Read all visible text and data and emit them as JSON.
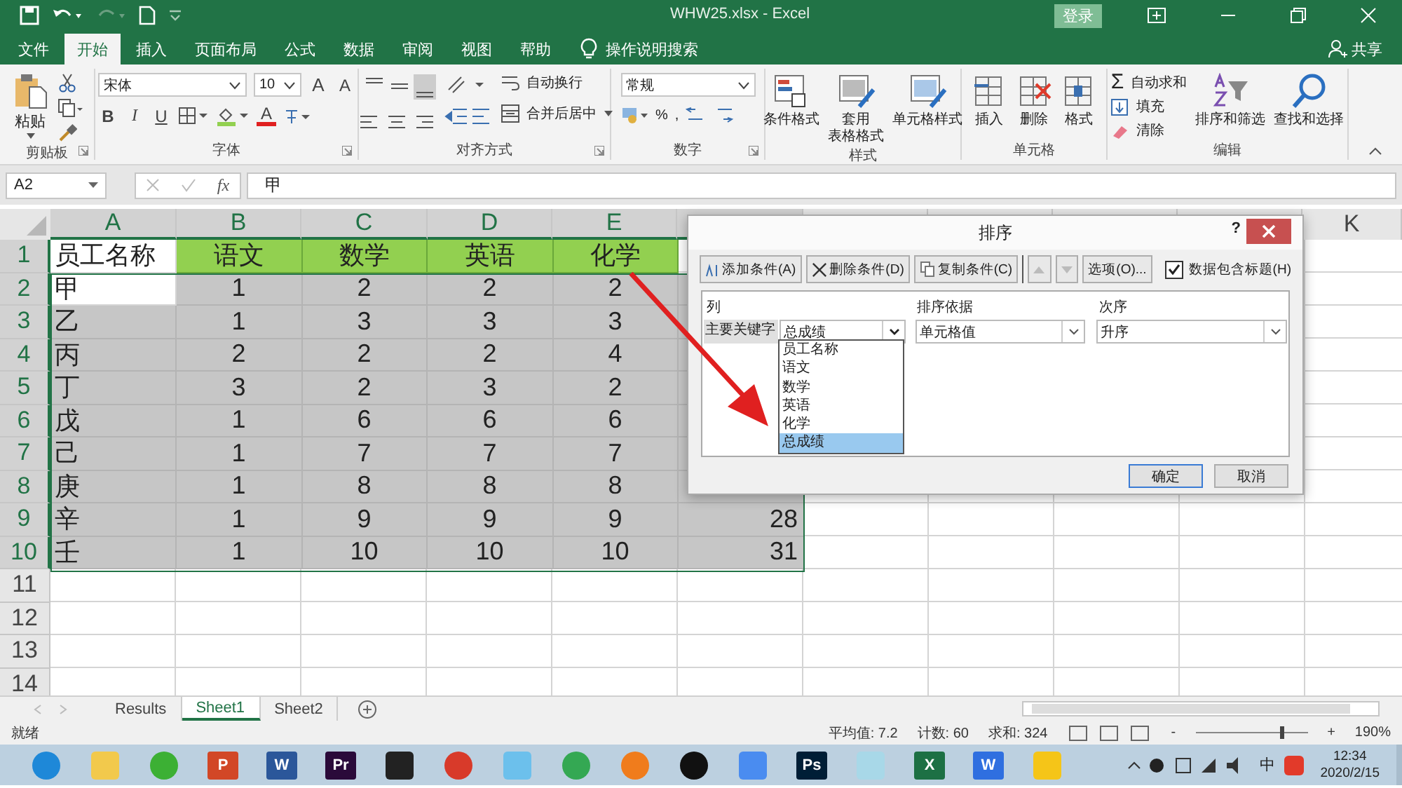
{
  "window": {
    "title": "WHW25.xlsx  -  Excel",
    "sign_in": "登录",
    "share": "共享"
  },
  "menu_tabs": [
    {
      "label": "文件",
      "selected": false
    },
    {
      "label": "开始",
      "selected": true
    },
    {
      "label": "插入",
      "selected": false
    },
    {
      "label": "页面布局",
      "selected": false
    },
    {
      "label": "公式",
      "selected": false
    },
    {
      "label": "数据",
      "selected": false
    },
    {
      "label": "审阅",
      "selected": false
    },
    {
      "label": "视图",
      "selected": false
    },
    {
      "label": "帮助",
      "selected": false
    }
  ],
  "tell_me": "操作说明搜索",
  "ribbon": {
    "clipboard": {
      "paste": "粘贴",
      "label": "剪贴板"
    },
    "font": {
      "name": "宋体",
      "size": "10",
      "grow": "A",
      "shrink": "A",
      "bold": "B",
      "italic": "I",
      "underline": "U",
      "color_glyph": "A",
      "label": "字体"
    },
    "alignment": {
      "wrap": "自动换行",
      "merge": "合并后居中",
      "label": "对齐方式"
    },
    "number": {
      "format": "常规",
      "percent": "%",
      "comma": ",",
      "label": "数字"
    },
    "styles": {
      "items": [
        {
          "lines": [
            "条件格式"
          ]
        },
        {
          "lines": [
            "套用",
            "表格格式"
          ]
        },
        {
          "lines": [
            "单元格样式"
          ]
        }
      ],
      "label": "样式"
    },
    "cells": {
      "items": [
        "插入",
        "删除",
        "格式"
      ],
      "label": "单元格"
    },
    "editing": {
      "sum_symbol": "Σ",
      "autosum": "自动求和",
      "fill": "填充",
      "clear": "清除",
      "sort": "排序和筛选",
      "find": "查找和选择",
      "label": "编辑"
    }
  },
  "formula_bar": {
    "name_box": "A2",
    "fx": "fx",
    "value": "甲"
  },
  "sheet": {
    "column_headers": [
      "A",
      "B",
      "C",
      "D",
      "E"
    ],
    "far_column_header": "K",
    "header_row": {
      "number": "1",
      "name": "员工名称",
      "subjects": [
        "语文",
        "数学",
        "英语",
        "化学"
      ]
    },
    "rows": [
      {
        "number": "2",
        "name": "甲",
        "scores": [
          "1",
          "2",
          "2",
          "2"
        ],
        "selected": true,
        "active": true
      },
      {
        "number": "3",
        "name": "乙",
        "scores": [
          "1",
          "3",
          "3",
          "3"
        ],
        "selected": true,
        "active": false
      },
      {
        "number": "4",
        "name": "丙",
        "scores": [
          "2",
          "2",
          "2",
          "4"
        ],
        "selected": true,
        "active": false
      },
      {
        "number": "5",
        "name": "丁",
        "scores": [
          "3",
          "2",
          "3",
          "2"
        ],
        "selected": true,
        "active": false
      },
      {
        "number": "6",
        "name": "戊",
        "scores": [
          "1",
          "6",
          "6",
          "6"
        ],
        "selected": true,
        "active": false
      },
      {
        "number": "7",
        "name": "己",
        "scores": [
          "1",
          "7",
          "7",
          "7"
        ],
        "selected": true,
        "active": false
      },
      {
        "number": "8",
        "name": "庚",
        "scores": [
          "1",
          "8",
          "8",
          "8"
        ],
        "selected": true,
        "active": false
      },
      {
        "number": "9",
        "name": "辛",
        "scores": [
          "1",
          "9",
          "9",
          "9"
        ],
        "total": "28",
        "selected": true,
        "active": false
      },
      {
        "number": "10",
        "name": "壬",
        "scores": [
          "1",
          "10",
          "10",
          "10"
        ],
        "total": "31",
        "selected": true,
        "active": false
      }
    ],
    "empty_rows": [
      "11",
      "12",
      "13",
      "14"
    ]
  },
  "sheet_tabs": [
    {
      "label": "Results",
      "selected": false
    },
    {
      "label": "Sheet1",
      "selected": true
    },
    {
      "label": "Sheet2",
      "selected": false
    }
  ],
  "status_bar": {
    "mode": "就绪",
    "average": "平均值: 7.2",
    "count": "计数: 60",
    "sum": "求和: 324",
    "zoom_out": "-",
    "zoom_slider": {
      "level": 0.76
    },
    "zoom_in": "+",
    "zoom": "190%"
  },
  "sort_dialog": {
    "title": "排序",
    "help": "?",
    "add": "添加条件(A)",
    "delete": "删除条件(D)",
    "copy": "复制条件(C)",
    "options": "选项(O)...",
    "has_headers": {
      "label": "数据包含标题(H)",
      "checked": true
    },
    "headers": [
      "列",
      "排序依据",
      "次序"
    ],
    "row_label": "主要关键字",
    "column_value": "总成绩",
    "sort_on": "单元格值",
    "order": "升序",
    "dropdown": [
      {
        "label": "员工名称",
        "selected": false
      },
      {
        "label": "语文",
        "selected": false
      },
      {
        "label": "数学",
        "selected": false
      },
      {
        "label": "英语",
        "selected": false
      },
      {
        "label": "化学",
        "selected": false
      },
      {
        "label": "总成绩",
        "selected": true
      }
    ],
    "ok": "确定",
    "cancel": "取消"
  },
  "taskbar": {
    "apps": [
      {
        "kind": "circle",
        "color": "#1e88d8"
      },
      {
        "kind": "square",
        "color": "#f2c94c"
      },
      {
        "kind": "circle",
        "color": "#3cb034"
      },
      {
        "kind": "glyph",
        "color": "#d24726",
        "glyph": "P"
      },
      {
        "kind": "glyph",
        "color": "#2b579a",
        "glyph": "W"
      },
      {
        "kind": "glyph",
        "color": "#2a0a3a",
        "glyph": "Pr"
      },
      {
        "kind": "square",
        "color": "#222222"
      },
      {
        "kind": "circle",
        "color": "#d83a2a"
      },
      {
        "kind": "square",
        "color": "#6cc0ec"
      },
      {
        "kind": "circle",
        "color": "#34a853"
      },
      {
        "kind": "circle",
        "color": "#f07c1c"
      },
      {
        "kind": "circle",
        "color": "#111111"
      },
      {
        "kind": "square",
        "color": "#4a8cf0"
      },
      {
        "kind": "glyph",
        "color": "#001e36",
        "glyph": "Ps"
      },
      {
        "kind": "square",
        "color": "#a8d8e8"
      },
      {
        "kind": "glyph",
        "color": "#1d7044",
        "glyph": "X"
      },
      {
        "kind": "glyph",
        "color": "#2f6fe0",
        "glyph": "W"
      },
      {
        "kind": "square",
        "color": "#f5c518"
      }
    ],
    "ime": "中",
    "time": "12:34",
    "date": "2020/2/15"
  }
}
